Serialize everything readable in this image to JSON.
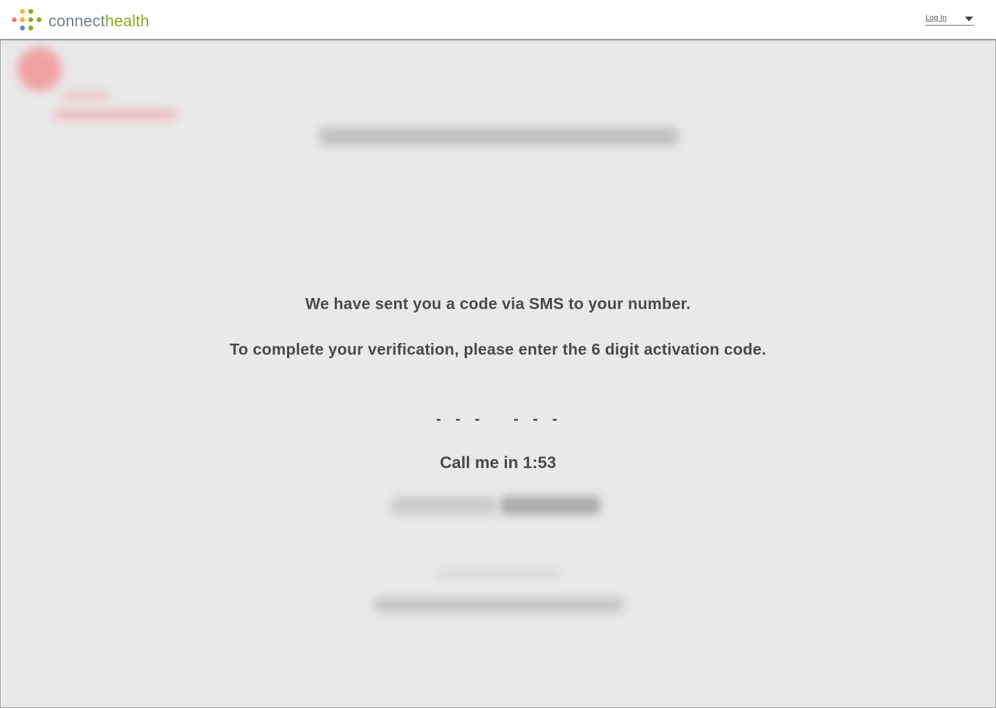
{
  "header": {
    "logo_text_part1": "connect",
    "logo_text_part2": "health",
    "logo_dot_colors": [
      "#ef7a7a",
      "#f2b13a",
      "#8aab22",
      "#4e86b9"
    ],
    "login_label": "Log In"
  },
  "verification": {
    "message_sent": "We have sent you a code via SMS to your number.",
    "message_enter": "To complete your verification, please enter the 6 digit activation code.",
    "code_placeholder_digits": [
      "-",
      "-",
      "-",
      "-",
      "-",
      "-"
    ],
    "call_me_prefix": "Call me in",
    "call_me_timer": "1:53"
  },
  "colors": {
    "text": "#4a4a4a",
    "overlay_bg": "#e9e9e9",
    "brand_green": "#8aab22",
    "brand_gray": "#6d7f86"
  }
}
